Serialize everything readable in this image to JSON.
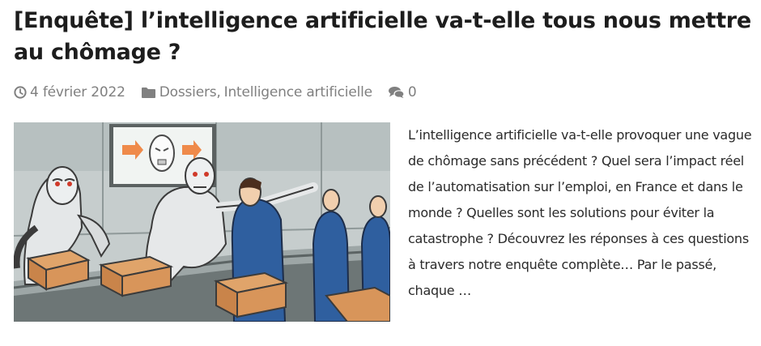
{
  "post": {
    "title": "[Enquête] l’intelligence artificielle va-t-elle tous nous mettre au chômage ?",
    "meta": {
      "date": "4 février 2022",
      "categories": [
        "Dossiers",
        "Intelligence artificielle"
      ],
      "category_separator": ", ",
      "comments_count": "0"
    },
    "image": {
      "icon": "illustration-robots-workers-assembly-line"
    },
    "excerpt": "L’intelligence artificielle va-t-elle provoquer une vague de chômage sans précédent ? Quel sera l’impact réel de l’automatisation sur l’emploi, en France et dans le monde ? Quelles sont les solutions pour éviter la catastrophe ? Découvrez les réponses à ces questions à travers notre enquête complète… Par le passé, chaque …"
  },
  "colors": {
    "title": "#1d1d1d",
    "meta": "#808080",
    "text": "#2a2a2a"
  }
}
